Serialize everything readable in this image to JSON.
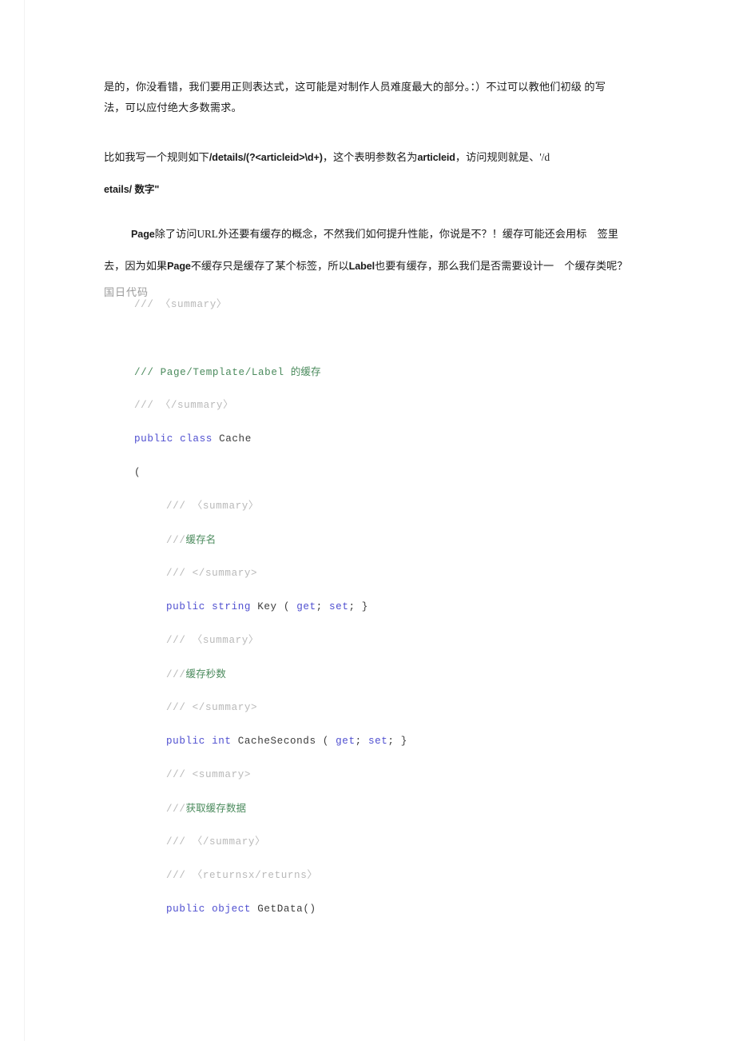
{
  "document": {
    "paragraphs": [
      {
        "id": "p1",
        "line1": "是的，你没看错，我们要用正则表达式，这可能是对制作人员难度最大的部分。：）不过可以教他们初级 的写",
        "line2": "法，可以应付绝大多数需求。"
      },
      {
        "id": "p2",
        "line1_pre": "比如我写一个规则如下",
        "line1_code": "/details/(?<articleid>\\d+)",
        "line1_mid": "，这个表明参数名为",
        "line1_code2": "articleid",
        "line1_post": "，访问规则就是、'/d",
        "line2": "etails/ 数字\""
      },
      {
        "id": "p3",
        "line1_lat": "Page",
        "line1_rest": "除了访问URL外还要有缓存的概念，不然我们如何提升性能，你说是不？！缓存可能还会用标　签里",
        "line2_a": "去，因为如果",
        "line2_lat": "Page",
        "line2_b": "不缓存只是缓存了某个标签，所以",
        "line2_lat2": "Label",
        "line2_c": "也要有缓存，那么我们是否需要设计一　个缓存类呢？"
      }
    ],
    "copy_code_label": "国日代码",
    "code_block": {
      "language": "csharp",
      "lines": [
        {
          "indent": 0,
          "tokens": [
            {
              "t": "/// ",
              "c": "cmt"
            },
            {
              "t": "〈summary〉",
              "c": "cmt"
            }
          ]
        },
        {
          "indent": 0,
          "tokens": []
        },
        {
          "indent": 0,
          "tokens": [
            {
              "t": "/// ",
              "c": "cmtg"
            },
            {
              "t": "Page/Template/Label ",
              "c": "cmtg"
            },
            {
              "t": "的缓存",
              "c": "cmtg-cn"
            }
          ]
        },
        {
          "indent": 0,
          "tokens": [
            {
              "t": "/// ",
              "c": "cmt"
            },
            {
              "t": "〈/summary〉",
              "c": "cmt"
            }
          ]
        },
        {
          "indent": 0,
          "tokens": [
            {
              "t": "public class ",
              "c": "kw"
            },
            {
              "t": "Cache",
              "c": "ident"
            }
          ]
        },
        {
          "indent": 0,
          "tokens": [
            {
              "t": "(",
              "c": "ident"
            }
          ]
        },
        {
          "indent": 1,
          "tokens": [
            {
              "t": "/// ",
              "c": "cmt"
            },
            {
              "t": "〈summary〉",
              "c": "cmt"
            }
          ]
        },
        {
          "indent": 1,
          "tokens": [
            {
              "t": "///",
              "c": "cmt"
            },
            {
              "t": "缓存名",
              "c": "cmtg-cn"
            }
          ]
        },
        {
          "indent": 1,
          "tokens": [
            {
              "t": "/// ",
              "c": "cmt"
            },
            {
              "t": "</summary>",
              "c": "cmt"
            }
          ]
        },
        {
          "indent": 1,
          "tokens": [
            {
              "t": "public string ",
              "c": "kw"
            },
            {
              "t": "Key ",
              "c": "ident"
            },
            {
              "t": "( ",
              "c": "ident"
            },
            {
              "t": "get",
              "c": "kw"
            },
            {
              "t": "; ",
              "c": "ident"
            },
            {
              "t": "set",
              "c": "kw"
            },
            {
              "t": "; }",
              "c": "ident"
            }
          ]
        },
        {
          "indent": 1,
          "tokens": [
            {
              "t": "/// ",
              "c": "cmt"
            },
            {
              "t": "〈summary〉",
              "c": "cmt"
            }
          ]
        },
        {
          "indent": 1,
          "tokens": [
            {
              "t": "///",
              "c": "cmt"
            },
            {
              "t": "缓存秒数",
              "c": "cmtg-cn"
            }
          ]
        },
        {
          "indent": 1,
          "tokens": [
            {
              "t": "/// ",
              "c": "cmt"
            },
            {
              "t": "</summary>",
              "c": "cmt"
            }
          ]
        },
        {
          "indent": 1,
          "tokens": [
            {
              "t": "public int ",
              "c": "kw"
            },
            {
              "t": "CacheSeconds ",
              "c": "ident"
            },
            {
              "t": "( ",
              "c": "ident"
            },
            {
              "t": "get",
              "c": "kw"
            },
            {
              "t": "; ",
              "c": "ident"
            },
            {
              "t": "set",
              "c": "kw"
            },
            {
              "t": "; }",
              "c": "ident"
            }
          ]
        },
        {
          "indent": 1,
          "tokens": [
            {
              "t": "/// ",
              "c": "cmt"
            },
            {
              "t": "<summary>",
              "c": "cmt"
            }
          ]
        },
        {
          "indent": 1,
          "tokens": [
            {
              "t": "///",
              "c": "cmt"
            },
            {
              "t": "获取缓存数据",
              "c": "cmtg-cn"
            }
          ]
        },
        {
          "indent": 1,
          "tokens": [
            {
              "t": "/// ",
              "c": "cmt"
            },
            {
              "t": "〈/summary〉",
              "c": "cmt"
            }
          ]
        },
        {
          "indent": 1,
          "tokens": [
            {
              "t": "/// ",
              "c": "cmt"
            },
            {
              "t": "〈returnsx/returns〉",
              "c": "cmt"
            }
          ]
        },
        {
          "indent": 1,
          "tokens": [
            {
              "t": "public object ",
              "c": "kw"
            },
            {
              "t": "GetData()",
              "c": "ident"
            }
          ]
        }
      ]
    }
  },
  "colors": {
    "keyword": "#4f4fd0",
    "comment": "#b9b9b9",
    "comment_green": "#4a8a5c",
    "identifier": "#3c3c3c",
    "body_text": "#1b1b1b",
    "copy_label": "#9a9a9a"
  }
}
